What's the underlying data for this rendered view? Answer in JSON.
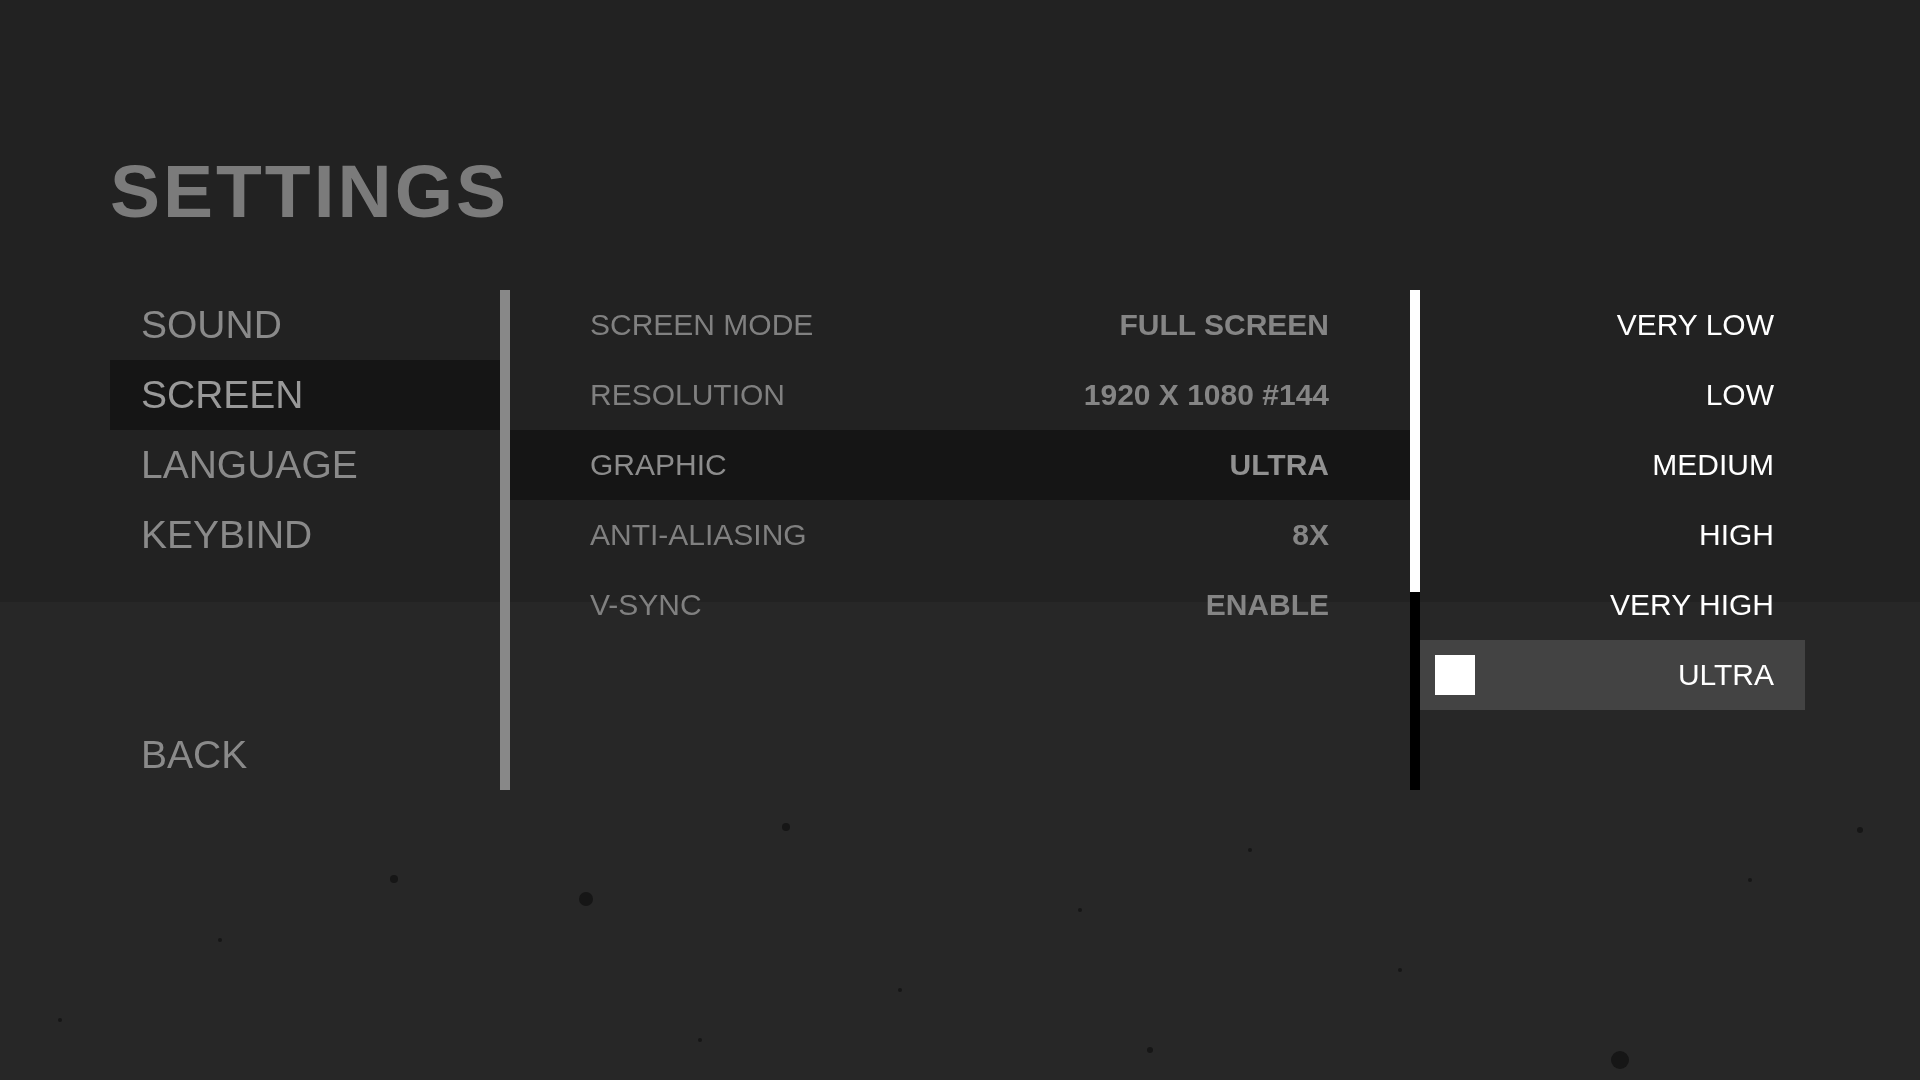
{
  "title": "SETTINGS",
  "sidebar": {
    "items": [
      {
        "label": "SOUND",
        "selected": false
      },
      {
        "label": "SCREEN",
        "selected": true
      },
      {
        "label": "LANGUAGE",
        "selected": false
      },
      {
        "label": "KEYBIND",
        "selected": false
      }
    ],
    "back": "BACK"
  },
  "settings_list": [
    {
      "label": "SCREEN MODE",
      "value": "FULL SCREEN",
      "selected": false
    },
    {
      "label": "RESOLUTION",
      "value": "1920 X 1080 #144",
      "selected": false
    },
    {
      "label": "GRAPHIC",
      "value": "ULTRA",
      "selected": true
    },
    {
      "label": "ANTI-ALIASING",
      "value": "8X",
      "selected": false
    },
    {
      "label": "V-SYNC",
      "value": "ENABLE",
      "selected": false
    }
  ],
  "dropdown": {
    "options": [
      {
        "label": "VERY LOW",
        "selected": false
      },
      {
        "label": "LOW",
        "selected": false
      },
      {
        "label": "MEDIUM",
        "selected": false
      },
      {
        "label": "HIGH",
        "selected": false
      },
      {
        "label": "VERY HIGH",
        "selected": false
      },
      {
        "label": "ULTRA",
        "selected": true
      }
    ]
  }
}
